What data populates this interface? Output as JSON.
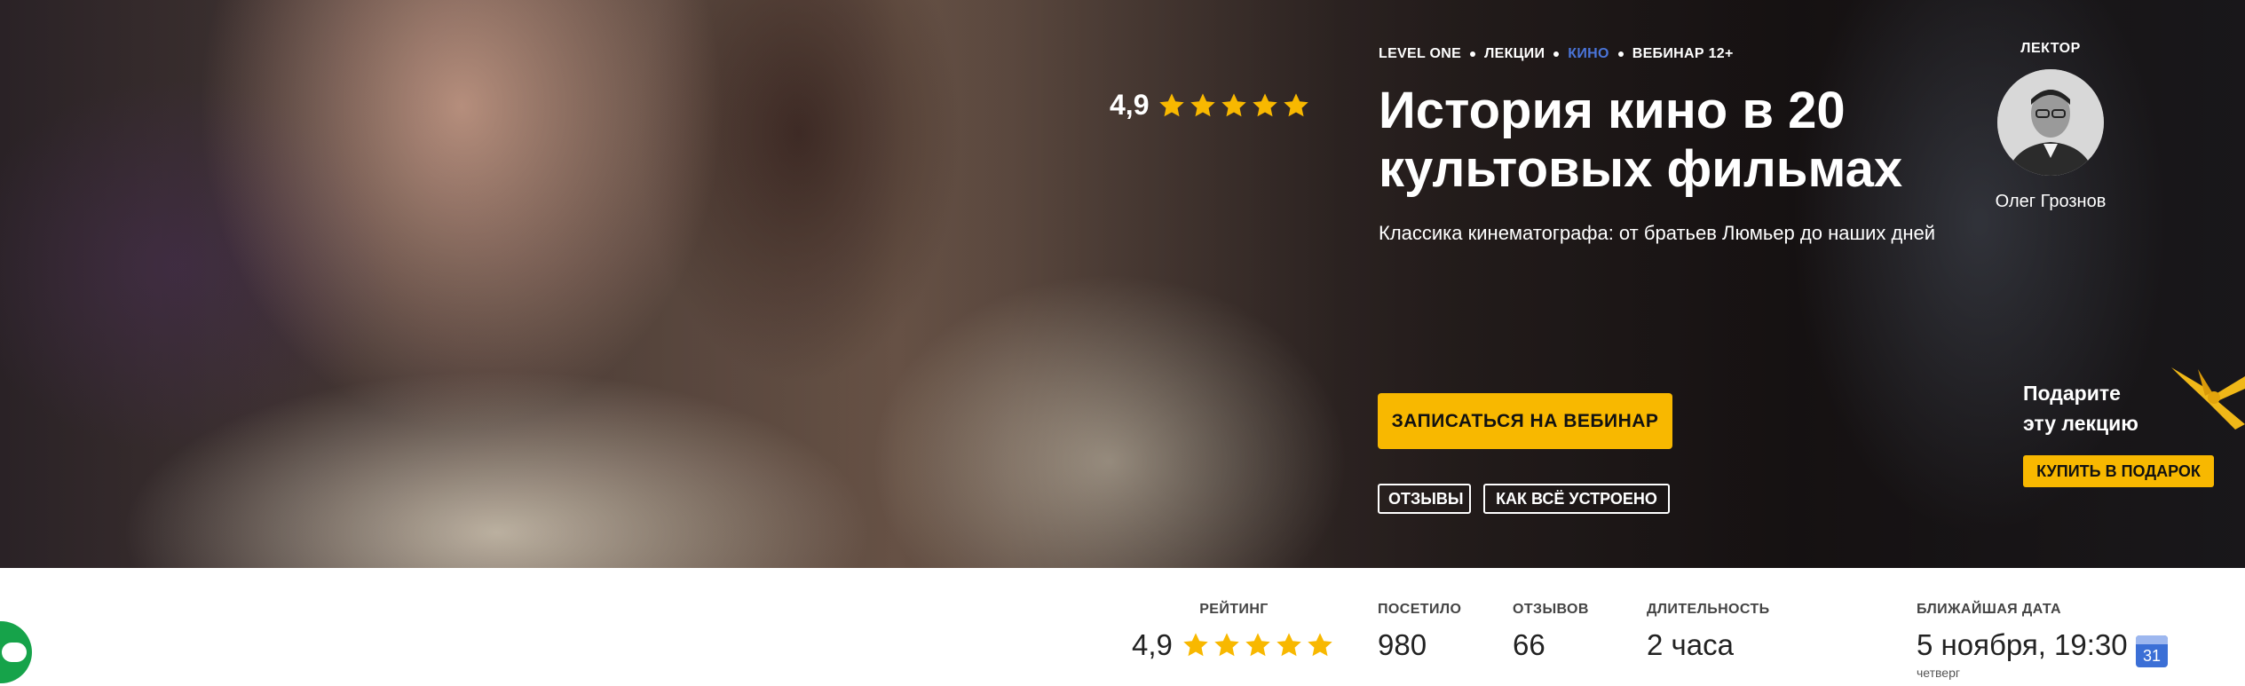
{
  "breadcrumbs": [
    "LEVEL ONE",
    "ЛЕКЦИИ",
    "КИНО",
    "ВЕБИНАР 12+"
  ],
  "hero": {
    "rating": "4,9",
    "rating_stars": 5,
    "title": "История кино в 20 культовых фильмах",
    "subtitle": "Классика кинематографа: от братьев Люмьер до наших дней",
    "cta_label": "ЗАПИСАТЬСЯ НА ВЕБИНАР",
    "reviews_pill": "ОТЗЫВЫ",
    "how_pill": "КАК ВСЁ УСТРОЕНО"
  },
  "lecturer": {
    "label": "ЛЕКТОР",
    "name": "Олег Грознов"
  },
  "gift": {
    "line1": "Подарите",
    "line2": "эту лекцию",
    "button_label": "КУПИТЬ В ПОДАРОК"
  },
  "stats": {
    "rating_label": "РЕЙТИНГ",
    "rating_value": "4,9",
    "visited_label": "ПОСЕТИЛО",
    "visited_value": "980",
    "reviews_label": "ОТЗЫВОВ",
    "reviews_value": "66",
    "duration_label": "ДЛИТЕЛЬНОСТЬ",
    "duration_value": "2 часа",
    "next_label": "БЛИЖАЙШАЯ ДАТА",
    "next_value": "5 ноября, 19:30",
    "next_weekday": "четверг",
    "calendar_day": "31"
  },
  "colors": {
    "accent_yellow": "#f8b800",
    "breadcrumb_accent": "#4a74d8",
    "star": "#f8b800",
    "chat_green": "#16a34a"
  },
  "icons": [
    "star-icon",
    "calendar-icon",
    "chat-icon",
    "gift-ribbon-icon"
  ]
}
